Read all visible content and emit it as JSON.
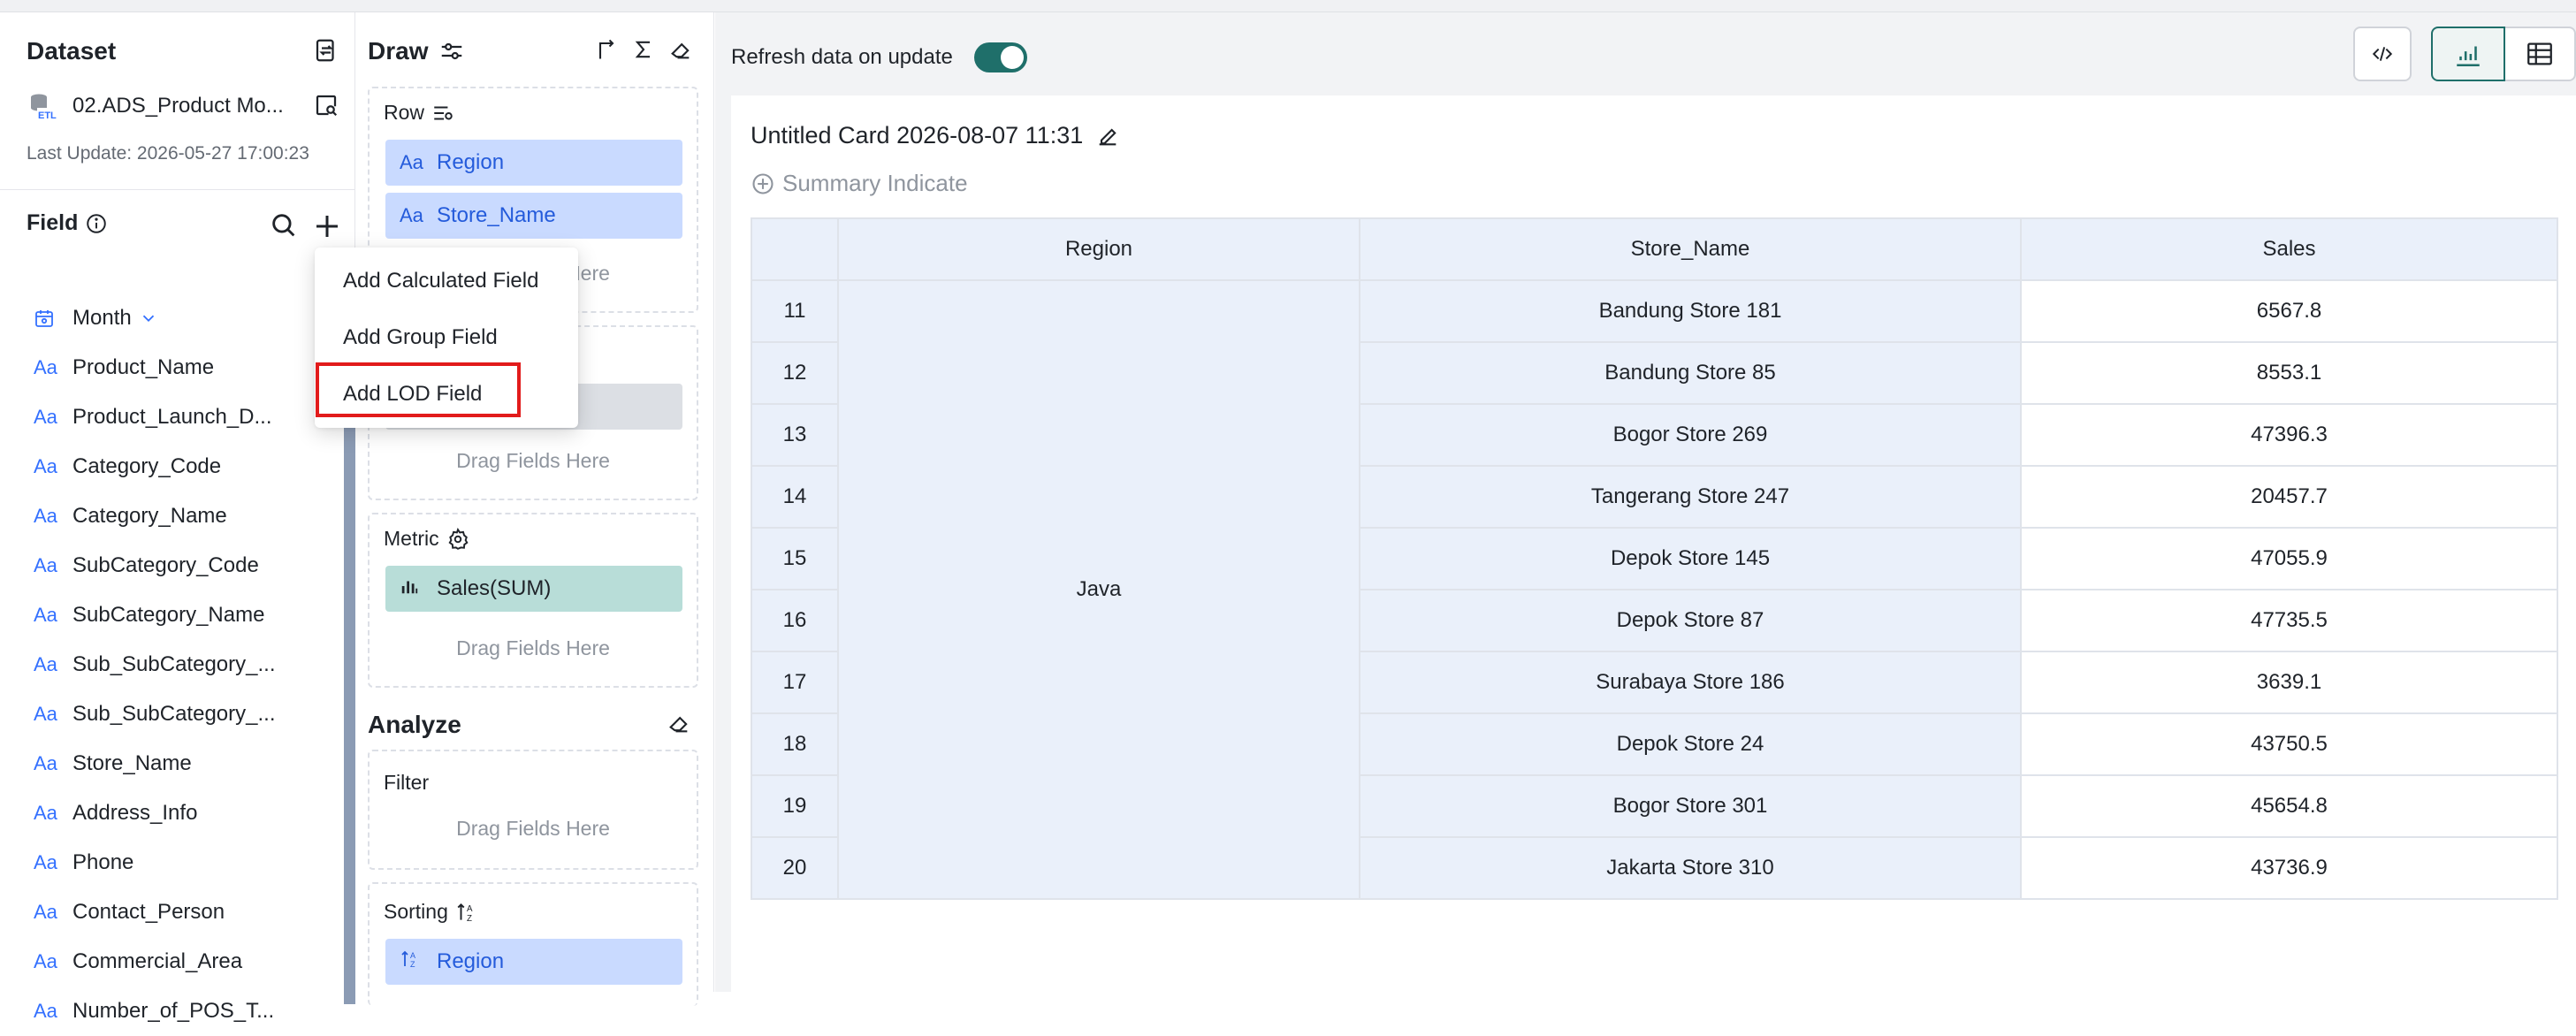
{
  "dataset": {
    "title": "Dataset",
    "name": "02.ADS_Product Mo...",
    "last_update": "Last Update: 2026-05-27 17:00:23"
  },
  "field_panel": {
    "title": "Field",
    "items": [
      {
        "type": "date",
        "name": "Month"
      },
      {
        "type": "Aa",
        "name": "Product_Name"
      },
      {
        "type": "Aa",
        "name": "Product_Launch_D..."
      },
      {
        "type": "Aa",
        "name": "Category_Code"
      },
      {
        "type": "Aa",
        "name": "Category_Name"
      },
      {
        "type": "Aa",
        "name": "SubCategory_Code"
      },
      {
        "type": "Aa",
        "name": "SubCategory_Name"
      },
      {
        "type": "Aa",
        "name": "Sub_SubCategory_..."
      },
      {
        "type": "Aa",
        "name": "Sub_SubCategory_..."
      },
      {
        "type": "Aa",
        "name": "Store_Name"
      },
      {
        "type": "Aa",
        "name": "Address_Info"
      },
      {
        "type": "Aa",
        "name": "Phone"
      },
      {
        "type": "Aa",
        "name": "Contact_Person"
      },
      {
        "type": "Aa",
        "name": "Commercial_Area"
      },
      {
        "type": "Aa",
        "name": "Number_of_POS_T..."
      }
    ]
  },
  "add_field_menu": {
    "items": [
      "Add Calculated Field",
      "Add Group Field",
      "Add LOD Field"
    ],
    "highlighted": "Add LOD Field"
  },
  "draw": {
    "title": "Draw",
    "row": {
      "label": "Row",
      "pills": [
        {
          "type": "Aa",
          "name": "Region"
        },
        {
          "type": "Aa",
          "name": "Store_Name"
        }
      ],
      "hint": "Drag Fields Here"
    },
    "column": {
      "hint": "Drag Fields Here"
    },
    "metric": {
      "label": "Metric",
      "pills": [
        {
          "name": "Sales(SUM)"
        }
      ],
      "hint": "Drag Fields Here"
    }
  },
  "analyze": {
    "title": "Analyze",
    "filter": {
      "label": "Filter",
      "hint": "Drag Fields Here"
    },
    "sorting": {
      "label": "Sorting",
      "pill": "Region"
    }
  },
  "toolbar": {
    "refresh_label": "Refresh data on update",
    "refresh_on": true
  },
  "card": {
    "title": "Untitled Card 2026-08-07 11:31",
    "summary": "Summary Indicate"
  },
  "table": {
    "columns": [
      "Region",
      "Store_Name",
      "Sales"
    ],
    "region": "Java",
    "rows": [
      {
        "idx": "11",
        "store": "Bandung Store 181",
        "sales": "6567.8"
      },
      {
        "idx": "12",
        "store": "Bandung Store 85",
        "sales": "8553.1"
      },
      {
        "idx": "13",
        "store": "Bogor Store 269",
        "sales": "47396.3"
      },
      {
        "idx": "14",
        "store": "Tangerang Store 247",
        "sales": "20457.7"
      },
      {
        "idx": "15",
        "store": "Depok Store 145",
        "sales": "47055.9"
      },
      {
        "idx": "16",
        "store": "Depok Store 87",
        "sales": "47735.5"
      },
      {
        "idx": "17",
        "store": "Surabaya Store 186",
        "sales": "3639.1"
      },
      {
        "idx": "18",
        "store": "Depok Store 24",
        "sales": "43750.5"
      },
      {
        "idx": "19",
        "store": "Bogor Store 301",
        "sales": "45654.8"
      },
      {
        "idx": "20",
        "store": "Jakarta Store 310",
        "sales": "43736.9"
      }
    ]
  },
  "colors": {
    "accent": "#1f6f6a",
    "pill_blue": "#c9daff",
    "pill_teal": "#b8ddd8",
    "highlight_border": "#e21b1b",
    "table_header_bg": "#eaf0fa"
  }
}
